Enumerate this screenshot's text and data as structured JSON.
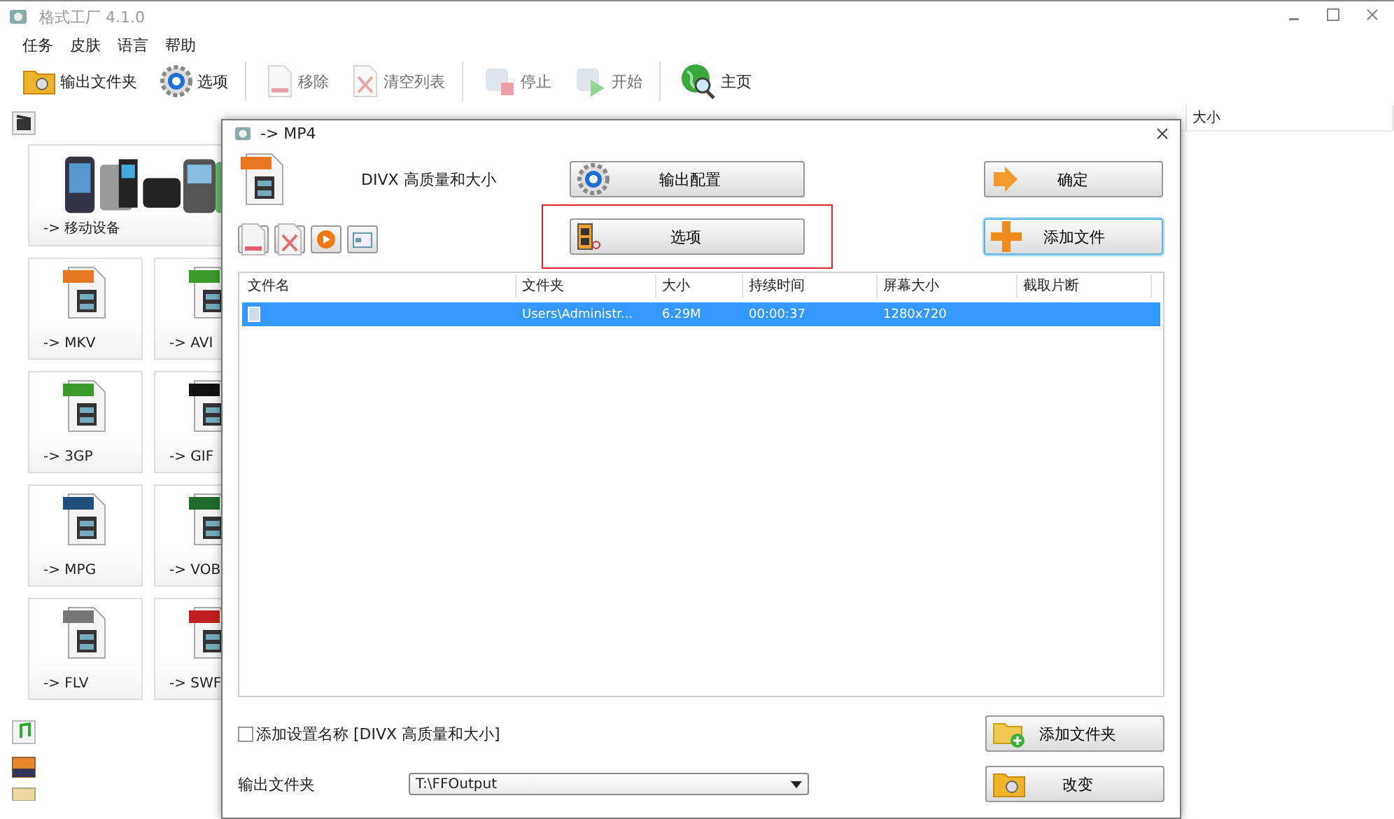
{
  "window": {
    "title": "格式工厂 4.1.0"
  },
  "menu": [
    {
      "label": "任务"
    },
    {
      "label": "皮肤"
    },
    {
      "label": "语言"
    },
    {
      "label": "帮助"
    }
  ],
  "toolbar": [
    {
      "label": "输出文件夹",
      "kind": "folder",
      "disabled": false
    },
    {
      "label": "选项",
      "kind": "gear",
      "disabled": false
    },
    {
      "label": "移除",
      "kind": "remove",
      "disabled": true
    },
    {
      "label": "清空列表",
      "kind": "clear",
      "disabled": true
    },
    {
      "label": "停止",
      "kind": "stop",
      "disabled": true
    },
    {
      "label": "开始",
      "kind": "start",
      "disabled": true
    },
    {
      "label": "主页",
      "kind": "globe",
      "disabled": false
    }
  ],
  "sidebar": {
    "featured": {
      "label": "-> 移动设备"
    },
    "tiles": [
      {
        "label": "-> MKV",
        "color": "#e87722"
      },
      {
        "label": "-> AVI",
        "color": "#3a9a2a"
      },
      {
        "label": "-> 3GP",
        "color": "#3a9a2a"
      },
      {
        "label": "-> GIF",
        "color": "#111111"
      },
      {
        "label": "-> MPG",
        "color": "#1f4e79"
      },
      {
        "label": "-> VOB",
        "color": "#1e6b2a"
      },
      {
        "label": "-> FLV",
        "color": "#777777"
      },
      {
        "label": "-> SWF",
        "color": "#c0201f"
      }
    ]
  },
  "task_list": {
    "visible_column": "大小"
  },
  "dialog": {
    "title": "-> MP4",
    "profile": "DIVX 高质量和大小",
    "buttons": [
      {
        "label": "输出配置",
        "kind": "gear",
        "highlighted": false,
        "focused": false
      },
      {
        "label": "确定",
        "kind": "arrow",
        "highlighted": false,
        "focused": false
      },
      {
        "label": "选项",
        "kind": "film",
        "highlighted": true,
        "focused": false
      },
      {
        "label": "添加文件",
        "kind": "plus",
        "highlighted": false,
        "focused": true
      }
    ],
    "table": {
      "columns": [
        "文件名",
        "文件夹",
        "大小",
        "持续时间",
        "屏幕大小",
        "截取片断"
      ],
      "rows": [
        {
          "selected": true,
          "cells": [
            "",
            "Users\\Administr...",
            "6.29M",
            "00:00:37",
            "1280x720",
            ""
          ]
        }
      ]
    },
    "name_option": {
      "label": "添加设置名称 [DIVX 高质量和大小]",
      "checked": false
    },
    "output_label": "输出文件夹",
    "output_value": "T:\\FFOutput",
    "bottom_buttons": [
      {
        "label": "添加文件夹",
        "kind": "folder-add"
      },
      {
        "label": "改变",
        "kind": "folder"
      }
    ]
  }
}
